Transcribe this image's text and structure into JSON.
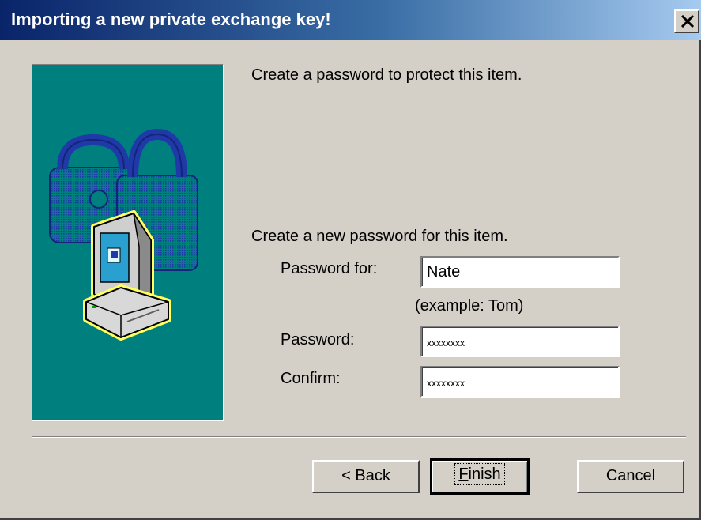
{
  "window": {
    "title": "Importing a new private exchange key!"
  },
  "main": {
    "intro": "Create a password to protect this item.",
    "section_heading": "Create a new password for this item.",
    "password_for": {
      "label": "Password for:",
      "value": "Nate",
      "example": "(example: Tom)"
    },
    "password": {
      "label": "Password:",
      "value": "xxxxxxxx"
    },
    "confirm": {
      "label": "Confirm:",
      "value": "xxxxxxxx"
    }
  },
  "buttons": {
    "back": "< Back",
    "finish_mnemonic": "F",
    "finish_rest": "inish",
    "cancel": "Cancel"
  },
  "icons": {
    "close": "close-icon",
    "illustration": "computer-lock-illustration"
  },
  "colors": {
    "title_start": "#0a246a",
    "title_end": "#a6caf0",
    "panel": "#007f7f",
    "face": "#d4d0c8"
  }
}
